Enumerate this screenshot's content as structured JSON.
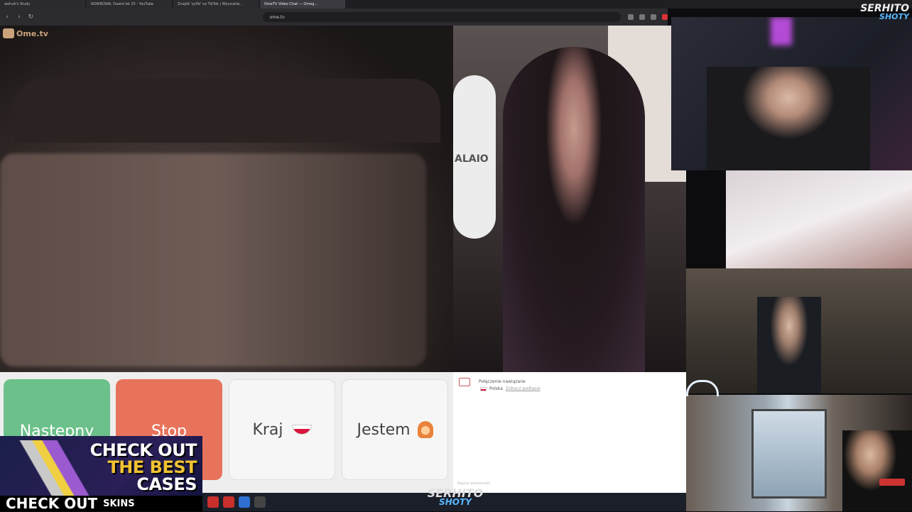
{
  "browser": {
    "tabs": [
      {
        "label": "wehuk's Study",
        "active": false
      },
      {
        "label": "NOWROWA, Dawid lat 25 - YouTube",
        "active": false
      },
      {
        "label": "Znajdź 'sylfd' na TikTok | Wyszukiw...",
        "active": false
      },
      {
        "label": "OmeTV Video Chat — Omeg...",
        "active": true
      }
    ],
    "url": "ome.tv",
    "back_icon": "‹",
    "forward_icon": "›",
    "reload_icon": "↻"
  },
  "site": {
    "logo_text": "Ome.tv",
    "partner_video_label": "ALAIO"
  },
  "controls": {
    "next_label": "Następny",
    "stop_label": "Stop",
    "country_label": "Kraj",
    "gender_label": "Jestem"
  },
  "chat": {
    "connection_message": "Połączenie nawiązane",
    "country": "Polska",
    "country_action": "Zobacz podlasie",
    "input_placeholder": "Napisz wiadomość"
  },
  "overlay_ad": {
    "line1": "CHECK OUT",
    "line2": "THE BEST",
    "line3": "CASES",
    "bottom_text": "CHECK OUT",
    "bottom_sub": "SKINS"
  },
  "watermark": {
    "top_line1": "SERHITO",
    "top_line2": "SHOTY",
    "bottom_line1": "SERHITO",
    "bottom_line2": "SHOTY"
  },
  "colors": {
    "next_button": "#6cc08a",
    "stop_button": "#e8735c",
    "ad_accent": "#f1c232",
    "watermark_accent": "#58b7ff"
  }
}
